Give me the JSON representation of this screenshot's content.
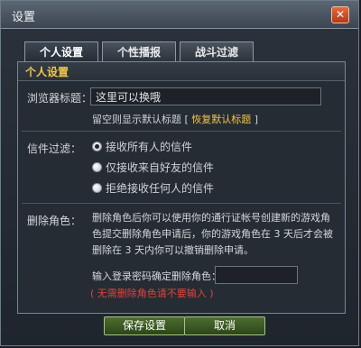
{
  "window": {
    "title": "设置",
    "close_glyph": "✕"
  },
  "tabs": [
    {
      "label": "个人设置",
      "active": true
    },
    {
      "label": "个性播报",
      "active": false
    },
    {
      "label": "战斗过滤",
      "active": false
    }
  ],
  "section": {
    "title": "个人设置"
  },
  "browser_title": {
    "label": "浏览器标题：",
    "value": "这里可以换哦",
    "hint_prefix": "留空则显示默认标题 [",
    "restore_link": "恢复默认标题",
    "hint_suffix": "]"
  },
  "mail_filter": {
    "label": "信件过滤：",
    "options": [
      {
        "label": "接收所有人的信件",
        "selected": true
      },
      {
        "label": "仅接收来自好友的信件",
        "selected": false
      },
      {
        "label": "拒绝接收任何人的信件",
        "selected": false
      }
    ]
  },
  "delete_role": {
    "label": "删除角色：",
    "description": "删除角色后你可以使用你的通行证帐号创建新的游戏角色提交删除角色申请后，你的游戏角色在 3 天后才会被删除在 3 天内你可以撤销删除申请。",
    "password_label": "输入登录密码确定删除角色：",
    "password_value": "",
    "warning": "( 无需删除角色请不要输入 )"
  },
  "buttons": {
    "save": "保存设置",
    "cancel": "取消"
  },
  "colors": {
    "accent": "#f4c54a",
    "warning": "#e0433a",
    "button": "#3b5a22"
  }
}
